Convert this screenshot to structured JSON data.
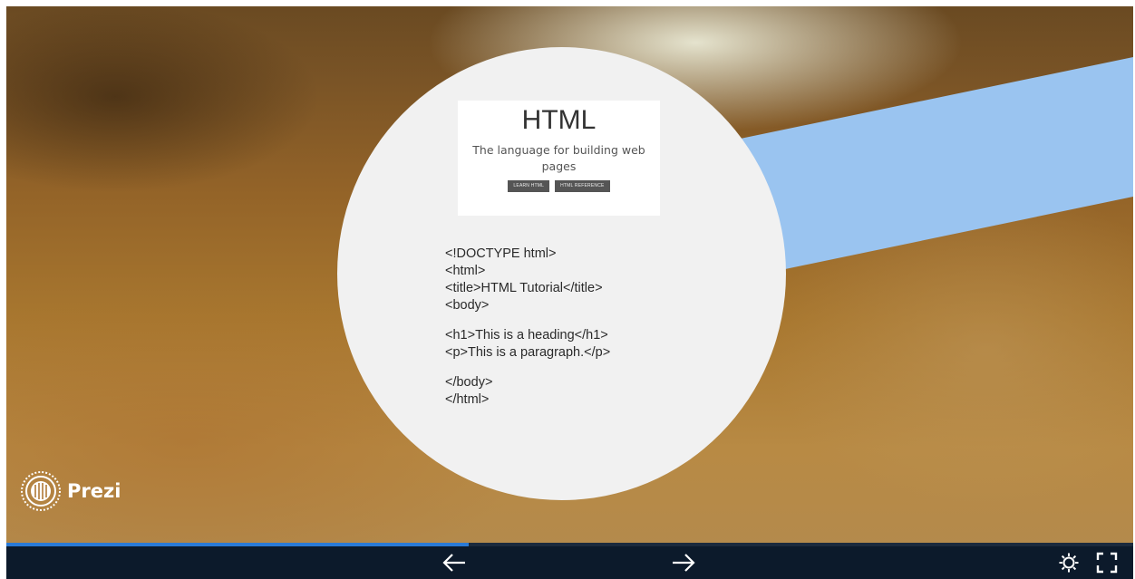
{
  "slide": {
    "card_title": "HTML",
    "card_subtitle": "The language for building web pages",
    "card_buttons": [
      "LEARN HTML",
      "HTML REFERENCE"
    ],
    "code_lines": [
      "<!DOCTYPE html>",
      "<html>",
      "<title>HTML Tutorial</title>",
      "<body>",
      "",
      "<h1>This is a heading</h1>",
      "<p>This is a paragraph.</p>",
      "",
      "</body>",
      "</html>"
    ]
  },
  "branding": {
    "logo_text": "Prezi"
  },
  "progress": {
    "fraction": 0.41
  },
  "toolbar": {
    "prev_icon": "arrow-left-icon",
    "next_icon": "arrow-right-icon",
    "settings_icon": "gear-icon",
    "fullscreen_icon": "fullscreen-icon"
  },
  "colors": {
    "stripe": "#9ac4f0",
    "circle": "#f1f1f1",
    "toolbar_bg": "#0c1a2b",
    "progress_fill": "#2a7ad6"
  }
}
